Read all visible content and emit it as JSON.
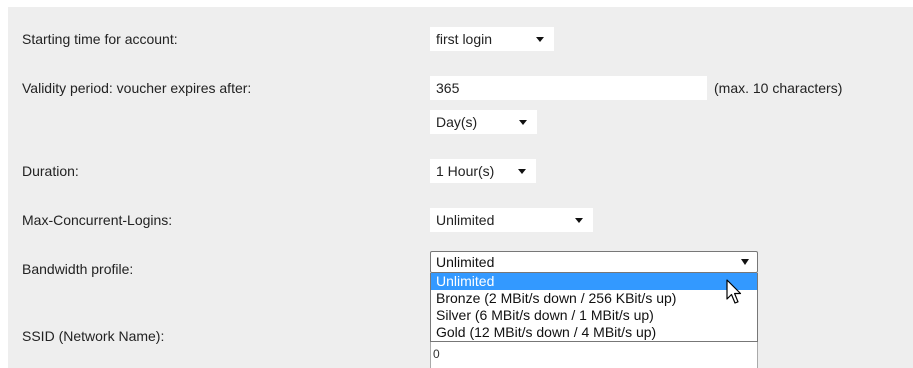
{
  "rows": {
    "starting_time": {
      "label": "Starting time for account:",
      "value": "first login"
    },
    "validity": {
      "label": "Validity period: voucher expires after:",
      "value": "365",
      "hint": "(max. 10 characters)",
      "unit": "Day(s)"
    },
    "duration": {
      "label": "Duration:",
      "value": "1 Hour(s)"
    },
    "max_logins": {
      "label": "Max-Concurrent-Logins:",
      "value": "Unlimited"
    },
    "bandwidth": {
      "label": "Bandwidth profile:",
      "value": "Unlimited",
      "options": [
        "Unlimited",
        "Bronze (2 MBit/s down / 256 KBit/s up)",
        "Silver (6 MBit/s down / 1 MBit/s up)",
        "Gold (12 MBit/s down / 4 MBit/s up)"
      ],
      "highlighted_option": "Unlimited"
    },
    "ssid": {
      "label": "SSID (Network Name):",
      "partial_value": "0"
    }
  },
  "colors": {
    "panel_bg": "#eeeeee",
    "highlight": "#3399ff"
  },
  "icons": {
    "cursor": "mouse-pointer-icon"
  }
}
